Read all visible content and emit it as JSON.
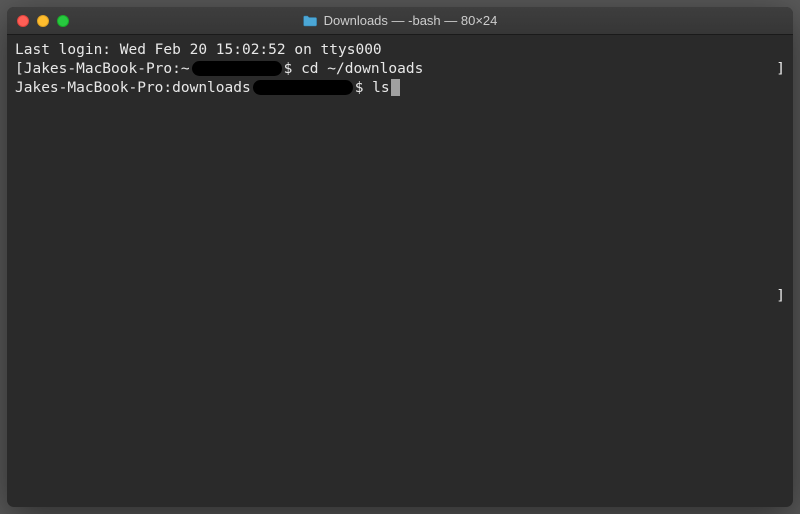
{
  "window": {
    "title": "Downloads — -bash — 80×24"
  },
  "terminal": {
    "login_line": "Last login: Wed Feb 20 15:02:52 on ttys000",
    "line1": {
      "prompt_host": "[Jakes-MacBook-Pro:~",
      "prompt_symbol": "$ ",
      "command": "cd ~/downloads"
    },
    "line2": {
      "prompt_host": "Jakes-MacBook-Pro:downloads",
      "prompt_symbol": "$ ",
      "command": "ls"
    },
    "bracket": "]"
  }
}
